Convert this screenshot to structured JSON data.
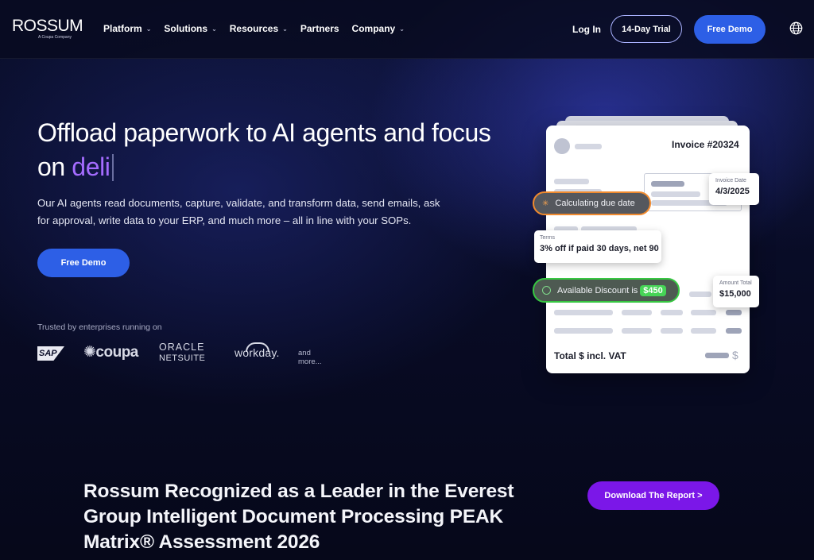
{
  "brand": {
    "name": "ROSSUM",
    "tagline": "A Coupa Company"
  },
  "nav": {
    "items": [
      {
        "label": "Platform",
        "has_dropdown": true
      },
      {
        "label": "Solutions",
        "has_dropdown": true
      },
      {
        "label": "Resources",
        "has_dropdown": true
      },
      {
        "label": "Partners",
        "has_dropdown": false
      },
      {
        "label": "Company",
        "has_dropdown": true
      }
    ],
    "login": "Log In",
    "trial": "14-Day Trial",
    "demo": "Free Demo",
    "language_icon": "globe-icon"
  },
  "hero": {
    "title": "Offload paperwork to AI agents and focus on",
    "typed_word": "deli",
    "description": "Our AI agents read documents, capture, validate, and transform data, send emails, ask for approval, write data to your ERP, and much more – all in line with your SOPs.",
    "cta": "Free Demo",
    "trusted_label": "Trusted by enterprises running on",
    "partner_logos": {
      "sap": "SAP",
      "coupa": "coupa",
      "oracle": "ORACLE",
      "netsuite": "NETSUITE",
      "workday": "workday.",
      "more": "and more..."
    }
  },
  "invoice_card": {
    "invoice_number": "Invoice #20324",
    "invoice_date_label": "Invoice Date",
    "invoice_date": "4/3/2025",
    "status_calculating": "Calculating due date",
    "terms_label": "Terms",
    "terms_value": "3% off if paid 30 days, net 90",
    "discount_text": "Available Discount is",
    "discount_amount": "$450",
    "amount_total_label": "Amount Total",
    "amount_total": "$15,000",
    "total_label": "Total $ incl. VAT",
    "currency_symbol": "$"
  },
  "report": {
    "title": "Rossum Recognized as a Leader in the Everest Group Intelligent Document Processing PEAK Matrix® Assessment 2026",
    "cta": "Download The Report >"
  },
  "colors": {
    "primary_button": "#2d5fe6",
    "report_button": "#7b17e8",
    "typed_accent": "#a46cff",
    "calc_border": "#f08a2e",
    "discount_border": "#37c742"
  }
}
